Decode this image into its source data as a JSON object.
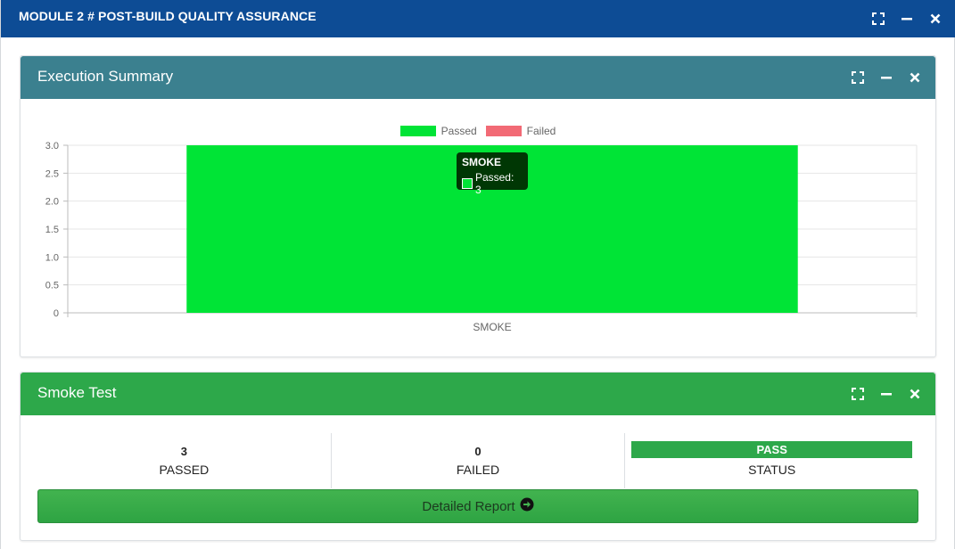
{
  "window": {
    "title": "MODULE 2 # POST-BUILD QUALITY ASSURANCE"
  },
  "execution_summary": {
    "title": "Execution Summary",
    "legend": [
      {
        "label": "Passed",
        "color": "#00e436"
      },
      {
        "label": "Failed",
        "color": "#f26a75"
      }
    ],
    "tooltip": {
      "title": "SMOKE",
      "line": "Passed: 3"
    }
  },
  "chart_data": {
    "type": "bar",
    "categories": [
      "SMOKE"
    ],
    "series": [
      {
        "name": "Passed",
        "values": [
          3
        ],
        "color": "#00e436"
      },
      {
        "name": "Failed",
        "values": [
          0
        ],
        "color": "#f26a75"
      }
    ],
    "ylim": [
      0,
      3
    ],
    "yticks": [
      "0",
      "0.5",
      "1.0",
      "1.5",
      "2.0",
      "2.5",
      "3.0"
    ],
    "grid": true,
    "legend_position": "top"
  },
  "smoke_test": {
    "title": "Smoke Test",
    "passed": {
      "value": "3",
      "label": "PASSED"
    },
    "failed": {
      "value": "0",
      "label": "FAILED"
    },
    "status": {
      "value": "PASS",
      "label": "STATUS"
    },
    "report_button": "Detailed Report"
  },
  "icons": [
    "expand-icon",
    "minimize-icon",
    "close-icon",
    "arrow-circle-right-icon"
  ]
}
